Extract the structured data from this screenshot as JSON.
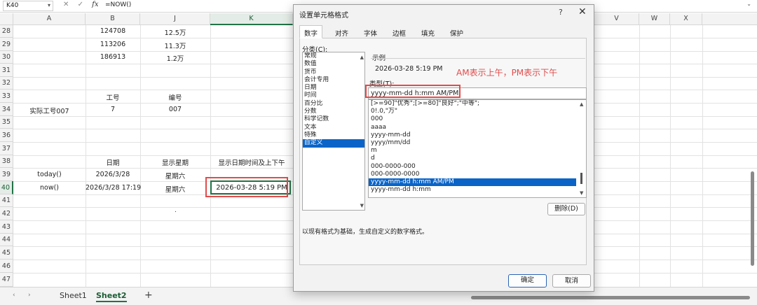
{
  "formula_bar": {
    "name_box": "K40",
    "cancel_icon": "✕",
    "enter_icon": "✓",
    "fx_label": "fx",
    "formula": "=NOW()"
  },
  "columns": [
    "A",
    "B",
    "J",
    "K",
    "V",
    "W",
    "X"
  ],
  "rows": [
    "28",
    "29",
    "30",
    "31",
    "32",
    "33",
    "34",
    "35",
    "36",
    "37",
    "38",
    "39",
    "40",
    "41",
    "42",
    "43",
    "44",
    "45",
    "46",
    "47"
  ],
  "cells": {
    "b28": "124708",
    "j28": "12.5万",
    "b29": "113206",
    "j29": "11.3万",
    "b30": "186913",
    "j30": "1.2万",
    "b33": "工号",
    "j33": "编号",
    "a34": "实际工号007",
    "b34": "7",
    "j34": "007",
    "b38": "日期",
    "j38": "显示星期",
    "k38": "显示日期时间及上下午",
    "a39": "today()",
    "b39": "2026/3/28",
    "j39": "星期六",
    "a40": "now()",
    "b40": "2026/3/28 17:19",
    "j40": "星期六",
    "k40": "2026-03-28 5:19 PM",
    "dot": "."
  },
  "sheet_tabs": {
    "prev": "‹",
    "next": "›",
    "sheet1": "Sheet1",
    "sheet2": "Sheet2",
    "add": "+"
  },
  "dialog": {
    "title": "设置单元格格式",
    "help": "?",
    "close": "✕",
    "tabs": [
      "数字",
      "对齐",
      "字体",
      "边框",
      "填充",
      "保护"
    ],
    "category_label": "分类(C):",
    "categories": [
      "常规",
      "数值",
      "货币",
      "会计专用",
      "日期",
      "时间",
      "百分比",
      "分数",
      "科学记数",
      "文本",
      "特殊",
      "自定义"
    ],
    "selected_category": "自定义",
    "sample_label": "示例",
    "sample_value": "2026-03-28 5:19 PM",
    "annotation": "AM表示上午，PM表示下午",
    "type_label": "类型(T):",
    "type_value": "yyyy-mm-dd h:mm AM/PM",
    "formats": [
      "[>=90]\"优秀\";[>=80]\"良好\";\"中等\";",
      "0!.0,\"万\"",
      "000",
      "aaaa",
      "yyyy-mm-dd",
      "yyyy/mm/dd",
      "m",
      "d",
      "000-0000-000",
      "000-0000-0000",
      "yyyy-mm-dd h:mm AM/PM",
      "yyyy-mm-dd h:mm"
    ],
    "selected_format": "yyyy-mm-dd h:mm AM/PM",
    "delete_button": "删除(D)",
    "description": "以现有格式为基础，生成自定义的数字格式。",
    "ok_button": "确定",
    "cancel_button": "取消"
  },
  "colors": {
    "accent_green": "#217346",
    "selection_blue": "#0a64c8",
    "annotation_red": "#e24b4b"
  }
}
